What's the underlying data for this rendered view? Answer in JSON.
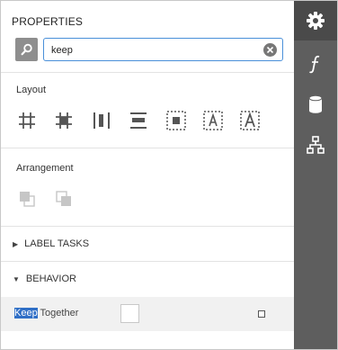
{
  "panel": {
    "title": "PROPERTIES",
    "search": {
      "value": "keep",
      "placeholder": ""
    }
  },
  "sections": {
    "layout": {
      "label": "Layout",
      "tools": [
        {
          "name": "grid-icon"
        },
        {
          "name": "grid-bold-icon"
        },
        {
          "name": "distribute-horizontal-icon"
        },
        {
          "name": "distribute-vertical-icon"
        },
        {
          "name": "center-in-container-icon"
        },
        {
          "name": "text-fit-icon"
        },
        {
          "name": "text-box-icon"
        }
      ]
    },
    "arrangement": {
      "label": "Arrangement",
      "tools": [
        {
          "name": "bring-to-front-icon"
        },
        {
          "name": "send-to-back-icon"
        }
      ]
    }
  },
  "groups": {
    "label_tasks": {
      "label": "LABEL TASKS",
      "expanded": false
    },
    "behavior": {
      "label": "BEHAVIOR",
      "expanded": true
    }
  },
  "properties": [
    {
      "highlight": "Keep",
      "rest": " Together",
      "checked": false
    }
  ],
  "sidebar_tabs": [
    {
      "name": "properties-gear-icon",
      "active": true
    },
    {
      "name": "expressions-function-icon",
      "active": false
    },
    {
      "name": "data-source-icon",
      "active": false
    },
    {
      "name": "report-explorer-icon",
      "active": false
    }
  ],
  "colors": {
    "accent": "#4a90d9",
    "highlight": "#2f6fc6",
    "rail": "#5e5e5e",
    "rail_active": "#4a4a4a"
  }
}
